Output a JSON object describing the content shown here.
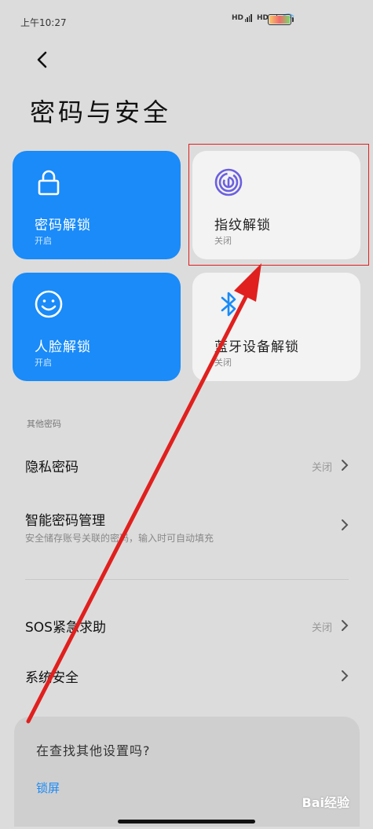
{
  "status_bar": {
    "time": "上午10:27",
    "hd1": "HD",
    "hd2": "HD"
  },
  "header": {
    "title": "密码与安全"
  },
  "cards": [
    {
      "label": "密码解锁",
      "status": "开启",
      "icon": "lock-icon"
    },
    {
      "label": "指纹解锁",
      "status": "关闭",
      "icon": "fingerprint-icon"
    },
    {
      "label": "人脸解锁",
      "status": "开启",
      "icon": "face-icon"
    },
    {
      "label": "蓝牙设备解锁",
      "status": "关闭",
      "icon": "bluetooth-icon"
    }
  ],
  "section": {
    "label": "其他密码"
  },
  "rows": [
    {
      "title": "隐私密码",
      "value": "关闭"
    },
    {
      "title": "智能密码管理",
      "subtitle": "安全储存账号关联的密码，输入时可自动填充"
    },
    {
      "title": "SOS紧急求助",
      "value": "关闭"
    },
    {
      "title": "系统安全"
    }
  ],
  "bottom": {
    "question": "在查找其他设置吗?",
    "link": "锁屏"
  },
  "watermark": "Bai经验",
  "colors": {
    "accent": "#1a8bf8",
    "background": "#dcdcdc",
    "card_off": "#f3f3f3",
    "annotation_red": "#e0201e"
  }
}
